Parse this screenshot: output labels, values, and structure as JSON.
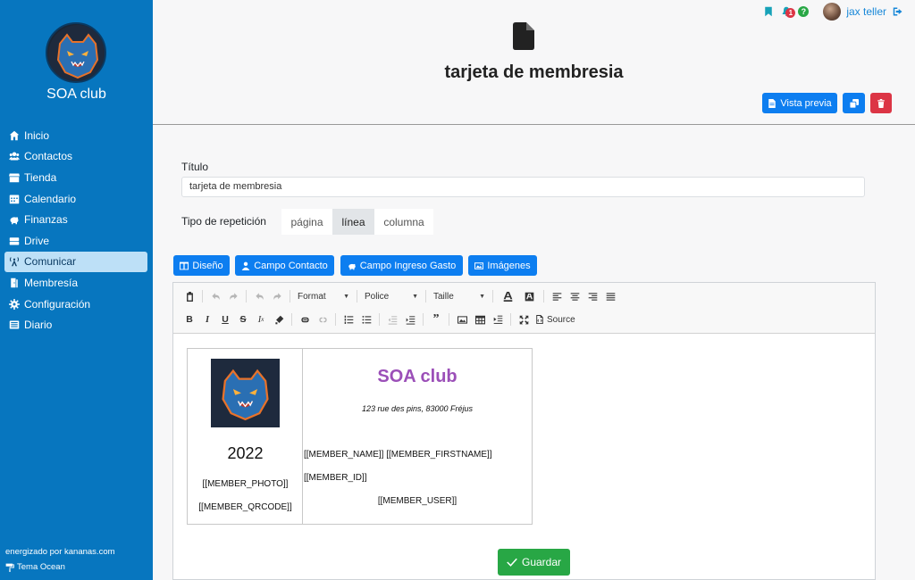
{
  "sidebar": {
    "club_name": "SOA club",
    "items": [
      {
        "label": "Inicio",
        "icon": "home-icon"
      },
      {
        "label": "Contactos",
        "icon": "users-icon"
      },
      {
        "label": "Tienda",
        "icon": "store-icon"
      },
      {
        "label": "Calendario",
        "icon": "calendar-icon"
      },
      {
        "label": "Finanzas",
        "icon": "piggy-bank-icon"
      },
      {
        "label": "Drive",
        "icon": "hard-drive-icon"
      },
      {
        "label": "Comunicar",
        "icon": "broadcast-icon"
      },
      {
        "label": "Membresía",
        "icon": "door-icon"
      },
      {
        "label": "Configuración",
        "icon": "gear-icon"
      },
      {
        "label": "Diario",
        "icon": "list-icon"
      }
    ],
    "active_item": "Comunicar",
    "powered_by": "energizado por kananas.com",
    "theme": "Tema Ocean"
  },
  "topbar": {
    "notification_count": "1",
    "help": "?",
    "username": "jax teller"
  },
  "header": {
    "title": "tarjeta de membresia",
    "preview_label": "Vista previa"
  },
  "form": {
    "title_label": "Título",
    "title_value": "tarjeta de membresia",
    "repeat_label": "Tipo de repetición",
    "repeat_options": [
      "página",
      "línea",
      "columna"
    ],
    "repeat_selected": "línea",
    "insert_buttons": [
      "Diseño",
      "Campo Contacto",
      "Campo Ingreso Gasto",
      "Imágenes"
    ]
  },
  "toolbar": {
    "format": "Format",
    "font": "Police",
    "size": "Taille",
    "source": "Source"
  },
  "card": {
    "year": "2022",
    "photo": "[[MEMBER_PHOTO]]",
    "qrcode": "[[MEMBER_QRCODE]]",
    "club": "SOA club",
    "address": "123 rue des pins, 83000 Fréjus",
    "names": "[[MEMBER_NAME]] [[MEMBER_FIRSTNAME]]",
    "id": "[[MEMBER_ID]]",
    "user": "[[MEMBER_USER]]"
  },
  "save_label": "Guardar",
  "colors": {
    "sidebar": "#0776bf",
    "primary": "#0d7ef0",
    "danger": "#dc3545",
    "success": "#28a745",
    "club_title": "#9b4fb8"
  }
}
